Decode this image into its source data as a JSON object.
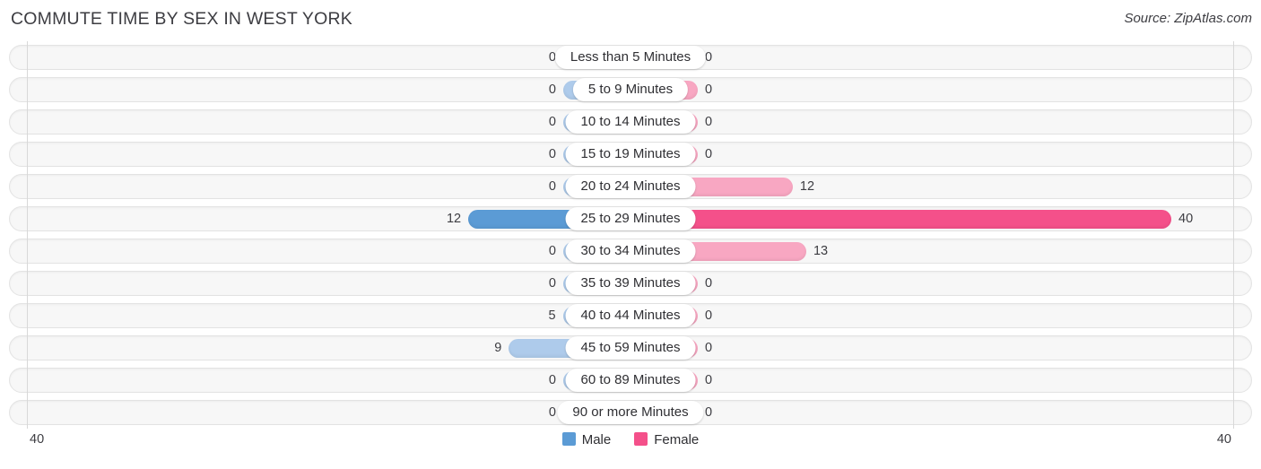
{
  "header": {
    "title": "COMMUTE TIME BY SEX IN WEST YORK",
    "source": "Source: ZipAtlas.com"
  },
  "axis": {
    "left_label": "40",
    "right_label": "40"
  },
  "legend": {
    "items": [
      {
        "label": "Male",
        "color": "#5b9bd5"
      },
      {
        "label": "Female",
        "color": "#f4508a"
      }
    ]
  },
  "chart_data": {
    "type": "bar",
    "title": "COMMUTE TIME BY SEX IN WEST YORK",
    "subtitle": "Source: ZipAtlas.com",
    "orientation": "horizontal-diverging",
    "xlabel": "",
    "ylabel": "",
    "xlim": [
      40,
      40
    ],
    "axis_max": 40,
    "grid": false,
    "legend_position": "bottom-center",
    "categories": [
      "Less than 5 Minutes",
      "5 to 9 Minutes",
      "10 to 14 Minutes",
      "15 to 19 Minutes",
      "20 to 24 Minutes",
      "25 to 29 Minutes",
      "30 to 34 Minutes",
      "35 to 39 Minutes",
      "40 to 44 Minutes",
      "45 to 59 Minutes",
      "60 to 89 Minutes",
      "90 or more Minutes"
    ],
    "series": [
      {
        "name": "Male",
        "side": "left",
        "color": "#aecbeb",
        "peak_color": "#5b9bd5",
        "values": [
          0,
          0,
          0,
          0,
          0,
          12,
          0,
          0,
          5,
          9,
          0,
          0
        ]
      },
      {
        "name": "Female",
        "side": "right",
        "color": "#f8a7c2",
        "peak_color": "#f4508a",
        "values": [
          0,
          0,
          0,
          0,
          12,
          40,
          13,
          0,
          0,
          0,
          0,
          0
        ]
      }
    ],
    "rows": [
      {
        "category": "Less than 5 Minutes",
        "male": 0,
        "female": 0,
        "male_text": "0",
        "female_text": "0"
      },
      {
        "category": "5 to 9 Minutes",
        "male": 0,
        "female": 0,
        "male_text": "0",
        "female_text": "0"
      },
      {
        "category": "10 to 14 Minutes",
        "male": 0,
        "female": 0,
        "male_text": "0",
        "female_text": "0"
      },
      {
        "category": "15 to 19 Minutes",
        "male": 0,
        "female": 0,
        "male_text": "0",
        "female_text": "0"
      },
      {
        "category": "20 to 24 Minutes",
        "male": 0,
        "female": 12,
        "male_text": "0",
        "female_text": "12"
      },
      {
        "category": "25 to 29 Minutes",
        "male": 12,
        "female": 40,
        "male_text": "12",
        "female_text": "40"
      },
      {
        "category": "30 to 34 Minutes",
        "male": 0,
        "female": 13,
        "male_text": "0",
        "female_text": "13"
      },
      {
        "category": "35 to 39 Minutes",
        "male": 0,
        "female": 0,
        "male_text": "0",
        "female_text": "0"
      },
      {
        "category": "40 to 44 Minutes",
        "male": 5,
        "female": 0,
        "male_text": "5",
        "female_text": "0"
      },
      {
        "category": "45 to 59 Minutes",
        "male": 9,
        "female": 0,
        "male_text": "9",
        "female_text": "0"
      },
      {
        "category": "60 to 89 Minutes",
        "male": 0,
        "female": 0,
        "male_text": "0",
        "female_text": "0"
      },
      {
        "category": "90 or more Minutes",
        "male": 0,
        "female": 0,
        "male_text": "0",
        "female_text": "0"
      }
    ]
  }
}
